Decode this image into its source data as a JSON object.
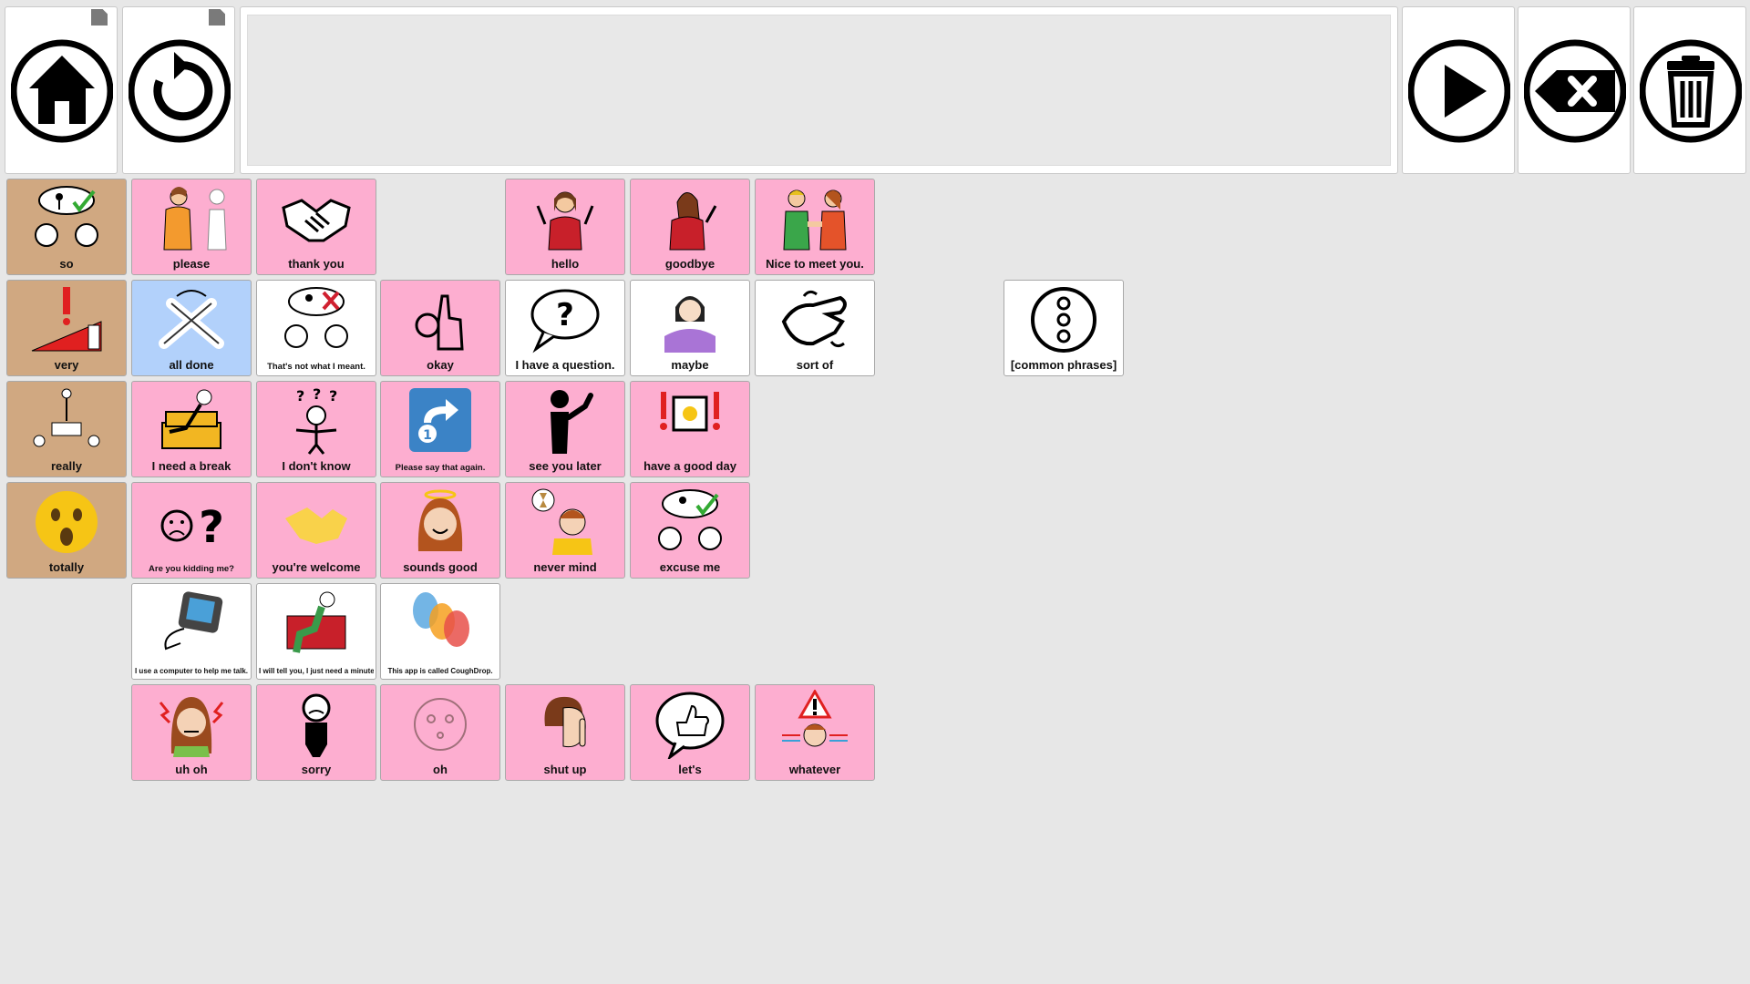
{
  "sentence": {
    "text": ""
  },
  "tiles": {
    "so": "so",
    "please": "please",
    "thank_you": "thank you",
    "hello": "hello",
    "goodbye": "goodbye",
    "nice_to_meet_you": "Nice to meet you.",
    "very": "very",
    "all_done": "all done",
    "thats_not_what": "That's not what I meant.",
    "okay": "okay",
    "question": "I have a question.",
    "maybe": "maybe",
    "sort_of": "sort of",
    "common_phrases": "[common phrases]",
    "really": "really",
    "need_break": "I need a break",
    "dont_know": "I don't know",
    "say_again": "Please say that again.",
    "see_you_later": "see you later",
    "good_day": "have a good day",
    "totally": "totally",
    "kidding": "Are you kidding me?",
    "youre_welcome": "you're welcome",
    "sounds_good": "sounds good",
    "never_mind": "never mind",
    "excuse_me": "excuse me",
    "computer": "I use a computer to help me talk.",
    "will_tell": "I will tell you, I just need a minute.",
    "app_called": "This app is called CoughDrop.",
    "uh_oh": "uh oh",
    "sorry": "sorry",
    "oh": "oh",
    "shut_up": "shut up",
    "lets": "let's",
    "whatever": "whatever"
  },
  "icons": {
    "home": "home-icon",
    "undo": "undo-icon",
    "speak": "play-icon",
    "backspace": "backspace-icon",
    "clear": "trash-icon"
  },
  "colors": {
    "pink": "#fdaed0",
    "tan": "#d0a881",
    "blue": "#b2d1fb",
    "white": "#ffffff",
    "background": "#e7e7e7"
  }
}
